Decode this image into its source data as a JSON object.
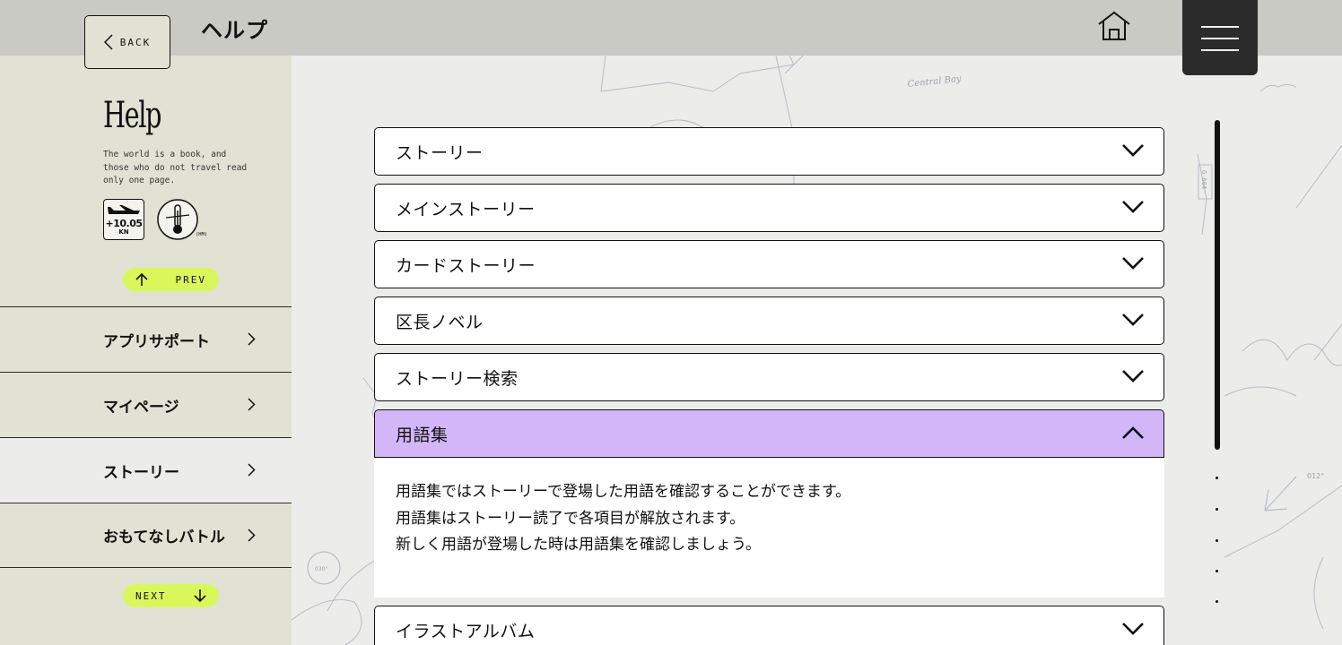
{
  "header": {
    "back_label": "BACK",
    "title": "ヘルプ"
  },
  "sidebar": {
    "heading": "Help",
    "description": "The world is a book, and those who do not travel read only one page.",
    "badge_speed": {
      "value": "+10.05",
      "unit": "KN"
    },
    "badge_temp_unit": "(HM)",
    "prev_label": "PREV",
    "next_label": "NEXT",
    "items": [
      {
        "label": "アプリサポート",
        "active": false
      },
      {
        "label": "マイページ",
        "active": false
      },
      {
        "label": "ストーリー",
        "active": true
      },
      {
        "label": "おもてなしバトル",
        "active": false
      }
    ]
  },
  "map_labels": {
    "bay": "Central Bay",
    "bearing": "012°",
    "compass": "030°",
    "route": "G 604"
  },
  "accordion": {
    "items": [
      {
        "label": "ストーリー",
        "expanded": false
      },
      {
        "label": "メインストーリー",
        "expanded": false
      },
      {
        "label": "カードストーリー",
        "expanded": false
      },
      {
        "label": "区長ノベル",
        "expanded": false
      },
      {
        "label": "ストーリー検索",
        "expanded": false
      },
      {
        "label": "用語集",
        "expanded": true,
        "body": [
          "用語集ではストーリーで登場した用語を確認することができます。",
          "用語集はストーリー読了で各項目が解放されます。",
          "新しく用語が登場した時は用語集を確認しましょう。"
        ]
      },
      {
        "label": "イラストアルバム",
        "expanded": false
      }
    ]
  },
  "colors": {
    "header_bg": "#c9cac4",
    "sidebar_bg": "#e1e2d4",
    "expanded_bg": "#d2b6f8",
    "nav_button_bg": "#d9f75a",
    "menu_bg": "#2b2b2b"
  }
}
